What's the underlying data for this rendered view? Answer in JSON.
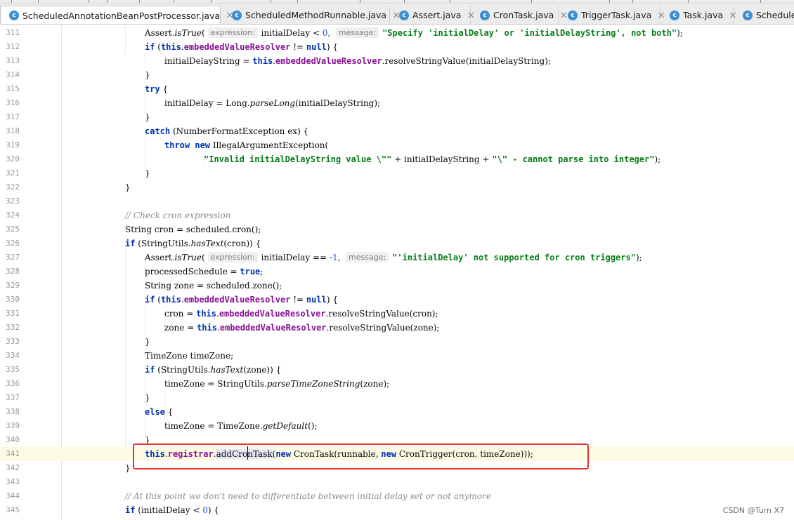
{
  "tabs": [
    {
      "label": "ScheduledAnnotationBeanPostProcessor.java",
      "active": true,
      "icon": "class-icon"
    },
    {
      "label": "ScheduledMethodRunnable.java",
      "active": false,
      "icon": "class-icon"
    },
    {
      "label": "Assert.java",
      "active": false,
      "icon": "class-icon"
    },
    {
      "label": "CronTask.java",
      "active": false,
      "icon": "class-icon"
    },
    {
      "label": "TriggerTask.java",
      "active": false,
      "icon": "class-icon"
    },
    {
      "label": "Task.java",
      "active": false,
      "icon": "class-icon"
    },
    {
      "label": "Scheduled",
      "active": false,
      "icon": "class-icon"
    }
  ],
  "tab_icon_glyph": "c",
  "tab_close_glyph": "×",
  "colors": {
    "keyword": "#0033b3",
    "field": "#871094",
    "string": "#067d17",
    "comment": "#8c8c8c",
    "number": "#1750eb",
    "highlight_box": "#e5322b",
    "current_line": "#fdfae4"
  },
  "editor": {
    "lines": [
      {
        "number": "311",
        "indent": 4,
        "tokens": [
          [
            "t",
            "Assert."
          ],
          [
            "i",
            "isTrue"
          ],
          [
            "t",
            "( "
          ],
          [
            "h",
            "expression:"
          ],
          [
            "t",
            "initialDelay < "
          ],
          [
            "n",
            "0"
          ],
          [
            "t",
            ",  "
          ],
          [
            "h",
            "message:"
          ],
          [
            "s",
            "\"Specify 'initialDelay' or 'initialDelayString', not both\""
          ],
          [
            "t",
            ");"
          ]
        ]
      },
      {
        "number": "312",
        "indent": 4,
        "tokens": [
          [
            "k",
            "if"
          ],
          [
            "t",
            " ("
          ],
          [
            "k",
            "this"
          ],
          [
            "t",
            "."
          ],
          [
            "f",
            "embeddedValueResolver"
          ],
          [
            "t",
            " != "
          ],
          [
            "k",
            "null"
          ],
          [
            "t",
            ") {"
          ]
        ]
      },
      {
        "number": "313",
        "indent": 5,
        "tokens": [
          [
            "t",
            "initialDelayString = "
          ],
          [
            "k",
            "this"
          ],
          [
            "t",
            "."
          ],
          [
            "f",
            "embeddedValueResolver"
          ],
          [
            "t",
            ".resolveStringValue(initialDelayString);"
          ]
        ]
      },
      {
        "number": "314",
        "indent": 4,
        "tokens": [
          [
            "t",
            "}"
          ]
        ]
      },
      {
        "number": "315",
        "indent": 4,
        "tokens": [
          [
            "k",
            "try"
          ],
          [
            "t",
            " {"
          ]
        ]
      },
      {
        "number": "316",
        "indent": 5,
        "tokens": [
          [
            "t",
            "initialDelay = Long."
          ],
          [
            "i",
            "parseLong"
          ],
          [
            "t",
            "(initialDelayString);"
          ]
        ]
      },
      {
        "number": "317",
        "indent": 4,
        "tokens": [
          [
            "t",
            "}"
          ]
        ]
      },
      {
        "number": "318",
        "indent": 4,
        "tokens": [
          [
            "k",
            "catch"
          ],
          [
            "t",
            " (NumberFormatException ex) {"
          ]
        ]
      },
      {
        "number": "319",
        "indent": 5,
        "tokens": [
          [
            "k",
            "throw new"
          ],
          [
            "t",
            " IllegalArgumentException("
          ]
        ]
      },
      {
        "number": "320",
        "indent": 7,
        "tokens": [
          [
            "s",
            "\"Invalid initialDelayString value \\\"\""
          ],
          [
            "t",
            " + initialDelayString + "
          ],
          [
            "s",
            "\"\\\" - cannot parse into integer\""
          ],
          [
            "t",
            ");"
          ]
        ]
      },
      {
        "number": "321",
        "indent": 4,
        "tokens": [
          [
            "t",
            "}"
          ]
        ]
      },
      {
        "number": "322",
        "indent": 3,
        "tokens": [
          [
            "t",
            "}"
          ]
        ]
      },
      {
        "number": "323",
        "indent": 0,
        "tokens": []
      },
      {
        "number": "324",
        "indent": 3,
        "tokens": [
          [
            "c",
            "// Check cron expression"
          ]
        ]
      },
      {
        "number": "325",
        "indent": 3,
        "tokens": [
          [
            "t",
            "String cron = scheduled.cron();"
          ]
        ]
      },
      {
        "number": "326",
        "indent": 3,
        "tokens": [
          [
            "k",
            "if"
          ],
          [
            "t",
            " (StringUtils."
          ],
          [
            "i",
            "hasText"
          ],
          [
            "t",
            "(cron)) {"
          ]
        ]
      },
      {
        "number": "327",
        "indent": 4,
        "tokens": [
          [
            "t",
            "Assert."
          ],
          [
            "i",
            "isTrue"
          ],
          [
            "t",
            "( "
          ],
          [
            "h",
            "expression:"
          ],
          [
            "t",
            "initialDelay == -"
          ],
          [
            "n",
            "1"
          ],
          [
            "t",
            ",  "
          ],
          [
            "h",
            "message:"
          ],
          [
            "s",
            "\"'initialDelay' not supported for cron triggers\""
          ],
          [
            "t",
            ");"
          ]
        ]
      },
      {
        "number": "328",
        "indent": 4,
        "tokens": [
          [
            "t",
            "processedSchedule = "
          ],
          [
            "k",
            "true"
          ],
          [
            "t",
            ";"
          ]
        ]
      },
      {
        "number": "329",
        "indent": 4,
        "tokens": [
          [
            "t",
            "String zone = scheduled.zone();"
          ]
        ]
      },
      {
        "number": "330",
        "indent": 4,
        "tokens": [
          [
            "k",
            "if"
          ],
          [
            "t",
            " ("
          ],
          [
            "k",
            "this"
          ],
          [
            "t",
            "."
          ],
          [
            "f",
            "embeddedValueResolver"
          ],
          [
            "t",
            " != "
          ],
          [
            "k",
            "null"
          ],
          [
            "t",
            ") {"
          ]
        ]
      },
      {
        "number": "331",
        "indent": 5,
        "tokens": [
          [
            "t",
            "cron = "
          ],
          [
            "k",
            "this"
          ],
          [
            "t",
            "."
          ],
          [
            "f",
            "embeddedValueResolver"
          ],
          [
            "t",
            ".resolveStringValue(cron);"
          ]
        ]
      },
      {
        "number": "332",
        "indent": 5,
        "tokens": [
          [
            "t",
            "zone = "
          ],
          [
            "k",
            "this"
          ],
          [
            "t",
            "."
          ],
          [
            "f",
            "embeddedValueResolver"
          ],
          [
            "t",
            ".resolveStringValue(zone);"
          ]
        ]
      },
      {
        "number": "333",
        "indent": 4,
        "tokens": [
          [
            "t",
            "}"
          ]
        ]
      },
      {
        "number": "334",
        "indent": 4,
        "tokens": [
          [
            "t",
            "TimeZone timeZone;"
          ]
        ]
      },
      {
        "number": "335",
        "indent": 4,
        "tokens": [
          [
            "k",
            "if"
          ],
          [
            "t",
            " (StringUtils."
          ],
          [
            "i",
            "hasText"
          ],
          [
            "t",
            "(zone)) {"
          ]
        ]
      },
      {
        "number": "336",
        "indent": 5,
        "tokens": [
          [
            "t",
            "timeZone = StringUtils."
          ],
          [
            "i",
            "parseTimeZoneString"
          ],
          [
            "t",
            "(zone);"
          ]
        ]
      },
      {
        "number": "337",
        "indent": 4,
        "tokens": [
          [
            "t",
            "}"
          ]
        ]
      },
      {
        "number": "338",
        "indent": 4,
        "tokens": [
          [
            "k",
            "else"
          ],
          [
            "t",
            " {"
          ]
        ]
      },
      {
        "number": "339",
        "indent": 5,
        "tokens": [
          [
            "t",
            "timeZone = TimeZone."
          ],
          [
            "i",
            "getDefault"
          ],
          [
            "t",
            "();"
          ]
        ]
      },
      {
        "number": "340",
        "indent": 4,
        "tokens": [
          [
            "t",
            "}"
          ]
        ]
      },
      {
        "number": "341",
        "indent": 4,
        "current": true,
        "tokens": [
          [
            "k",
            "this"
          ],
          [
            "t",
            "."
          ],
          [
            "f",
            "registrar"
          ],
          [
            "t",
            "."
          ],
          [
            "m",
            "addCronTask"
          ],
          [
            "t",
            "("
          ],
          [
            "k",
            "new"
          ],
          [
            "t",
            " CronTask(runnable, "
          ],
          [
            "k",
            "new"
          ],
          [
            "t",
            " CronTrigger(cron, timeZone)));"
          ]
        ]
      },
      {
        "number": "342",
        "indent": 3,
        "tokens": [
          [
            "t",
            "}"
          ]
        ]
      },
      {
        "number": "343",
        "indent": 0,
        "tokens": []
      },
      {
        "number": "344",
        "indent": 3,
        "tokens": [
          [
            "c",
            "// At this point we don't need to differentiate between initial delay set or not anymore"
          ]
        ]
      },
      {
        "number": "345",
        "indent": 3,
        "tokens": [
          [
            "k",
            "if"
          ],
          [
            "t",
            " (initialDelay < "
          ],
          [
            "n",
            "0"
          ],
          [
            "t",
            ") {"
          ]
        ]
      }
    ]
  },
  "watermark": "CSDN @Turn X7"
}
